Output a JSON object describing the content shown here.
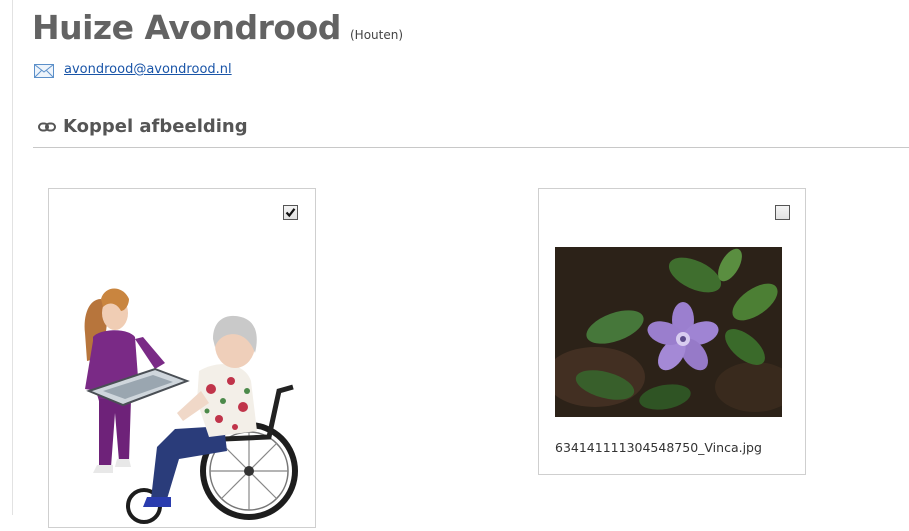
{
  "header": {
    "org_name": "Huize Avondrood",
    "org_city": "(Houten)",
    "email": "avondrood@avondrood.nl"
  },
  "section": {
    "title": "Koppel afbeelding"
  },
  "images": [
    {
      "checked": true,
      "icon": "nurse-wheelchair-photo",
      "caption": ""
    },
    {
      "checked": false,
      "icon": "vinca-flower-photo",
      "caption": "634141111304548750_Vinca.jpg"
    }
  ]
}
